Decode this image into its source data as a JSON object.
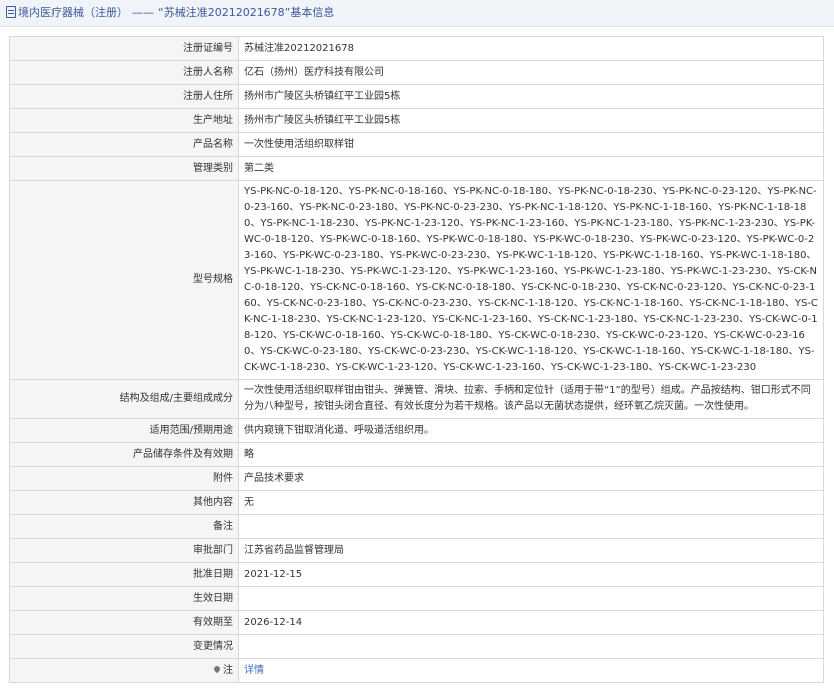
{
  "header": {
    "section": "境内医疗器械（注册）",
    "separator": "——",
    "title": "“苏械注准20212021678”基本信息"
  },
  "rows": [
    {
      "label": "注册证编号",
      "value": "苏械注准20212021678"
    },
    {
      "label": "注册人名称",
      "value": "亿石（扬州）医疗科技有限公司"
    },
    {
      "label": "注册人住所",
      "value": "扬州市广陵区头桥镇红平工业园5栋"
    },
    {
      "label": "生产地址",
      "value": "扬州市广陵区头桥镇红平工业园5栋"
    },
    {
      "label": "产品名称",
      "value": "一次性使用活组织取样钳"
    },
    {
      "label": "管理类别",
      "value": "第二类"
    },
    {
      "label": "型号规格",
      "value": "YS-PK-NC-0-18-120、YS-PK-NC-0-18-160、YS-PK-NC-0-18-180、YS-PK-NC-0-18-230、YS-PK-NC-0-23-120、YS-PK-NC-0-23-160、YS-PK-NC-0-23-180、YS-PK-NC-0-23-230、YS-PK-NC-1-18-120、YS-PK-NC-1-18-160、YS-PK-NC-1-18-180、YS-PK-NC-1-18-230、YS-PK-NC-1-23-120、YS-PK-NC-1-23-160、YS-PK-NC-1-23-180、YS-PK-NC-1-23-230、YS-PK-WC-0-18-120、YS-PK-WC-0-18-160、YS-PK-WC-0-18-180、YS-PK-WC-0-18-230、YS-PK-WC-0-23-120、YS-PK-WC-0-23-160、YS-PK-WC-0-23-180、YS-PK-WC-0-23-230、YS-PK-WC-1-18-120、YS-PK-WC-1-18-160、YS-PK-WC-1-18-180、YS-PK-WC-1-18-230、YS-PK-WC-1-23-120、YS-PK-WC-1-23-160、YS-PK-WC-1-23-180、YS-PK-WC-1-23-230、YS-CK-NC-0-18-120、YS-CK-NC-0-18-160、YS-CK-NC-0-18-180、YS-CK-NC-0-18-230、YS-CK-NC-0-23-120、YS-CK-NC-0-23-160、YS-CK-NC-0-23-180、YS-CK-NC-0-23-230、YS-CK-NC-1-18-120、YS-CK-NC-1-18-160、YS-CK-NC-1-18-180、YS-CK-NC-1-18-230、YS-CK-NC-1-23-120、YS-CK-NC-1-23-160、YS-CK-NC-1-23-180、YS-CK-NC-1-23-230、YS-CK-WC-0-18-120、YS-CK-WC-0-18-160、YS-CK-WC-0-18-180、YS-CK-WC-0-18-230、YS-CK-WC-0-23-120、YS-CK-WC-0-23-160、YS-CK-WC-0-23-180、YS-CK-WC-0-23-230、YS-CK-WC-1-18-120、YS-CK-WC-1-18-160、YS-CK-WC-1-18-180、YS-CK-WC-1-18-230、YS-CK-WC-1-23-120、YS-CK-WC-1-23-160、YS-CK-WC-1-23-180、YS-CK-WC-1-23-230"
    },
    {
      "label": "结构及组成/主要组成成分",
      "value": "一次性使用活组织取样钳由钳头、弹簧管、滑块、拉索、手柄和定位针（适用于带“1”的型号）组成。产品按结构、钳口形式不同分为八种型号，按钳头闭合直径、有效长度分为若干规格。该产品以无菌状态提供，经环氧乙烷灭菌。一次性使用。"
    },
    {
      "label": "适用范围/预期用途",
      "value": "供内窥镜下钳取消化道、呼吸道活组织用。"
    },
    {
      "label": "产品储存条件及有效期",
      "value": "略"
    },
    {
      "label": "附件",
      "value": "产品技术要求"
    },
    {
      "label": "其他内容",
      "value": "无"
    },
    {
      "label": "备注",
      "value": ""
    },
    {
      "label": "审批部门",
      "value": "江苏省药品监督管理局"
    },
    {
      "label": "批准日期",
      "value": "2021-12-15"
    },
    {
      "label": "生效日期",
      "value": ""
    },
    {
      "label": "有效期至",
      "value": "2026-12-14"
    },
    {
      "label": "变更情况",
      "value": ""
    }
  ],
  "note_row": {
    "label": "注",
    "icon": "pin-icon",
    "link_text": "详情"
  }
}
